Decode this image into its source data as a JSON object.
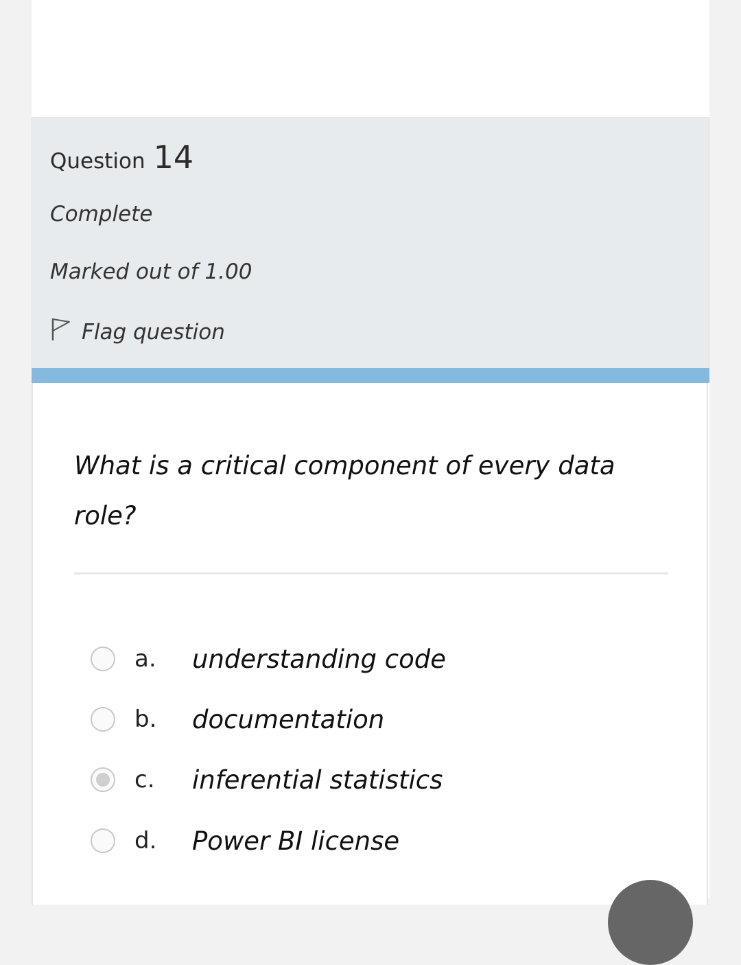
{
  "question_info": {
    "heading_word": "Question",
    "number": "14",
    "state": "Complete",
    "grade": "Marked out of 1.00",
    "flag_label": "Flag question"
  },
  "question": {
    "text": "What is a critical component of every data role?",
    "options": [
      {
        "letter": "a.",
        "text": "understanding code",
        "selected": false
      },
      {
        "letter": "b.",
        "text": "documentation",
        "selected": false
      },
      {
        "letter": "c.",
        "text": "inferential statistics",
        "selected": true
      },
      {
        "letter": "d.",
        "text": "Power BI license",
        "selected": false
      }
    ]
  },
  "icons": {
    "flag": "flag-outline-icon",
    "radio": "radio-circle-icon",
    "fab": "floating-action-button"
  },
  "colors": {
    "info_panel_bg": "#e7ebee",
    "accent_bar": "#86b9de",
    "page_bg": "#f2f2f2",
    "fab": "#666666"
  }
}
